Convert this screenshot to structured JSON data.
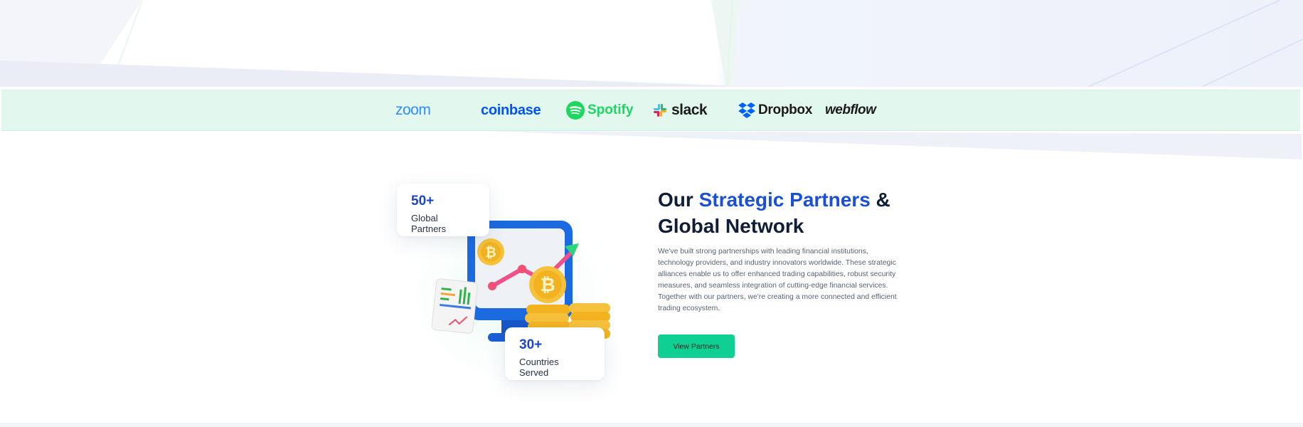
{
  "partners_strip": {
    "logos": [
      {
        "name": "zoom",
        "text": "zoom",
        "icon": "zoom-wordmark",
        "color": "#2d8cff"
      },
      {
        "name": "coinbase",
        "text": "coinbase",
        "icon": "coinbase-wordmark",
        "color": "#0052ff"
      },
      {
        "name": "spotify",
        "text": "Spotify",
        "icon": "spotify-icon",
        "color": "#1ed760"
      },
      {
        "name": "slack",
        "text": "slack",
        "icon": "slack-icon",
        "color": "#1d1c1d"
      },
      {
        "name": "dropbox",
        "text": "Dropbox",
        "icon": "dropbox-icon",
        "color": "#0061fe"
      },
      {
        "name": "webflow",
        "text": "webflow",
        "icon": "webflow-wordmark",
        "color": "#1a1a1a"
      }
    ],
    "background": "#e2f8ef"
  },
  "stats": [
    {
      "value": "50+",
      "label": "Global Partners"
    },
    {
      "value": "30+",
      "label": "Countries Served"
    }
  ],
  "section": {
    "title_prefix": "Our ",
    "title_accent": "Strategic Partners",
    "title_suffix": " & Global Network",
    "description": "We've built strong partnerships with leading financial institutions, technology providers, and industry innovators worldwide. These strategic alliances enable us to offer enhanced trading capabilities, robust security measures, and seamless integration of cutting-edge financial services. Together with our partners, we're creating a more connected and efficient trading ecosystem.",
    "cta_label": "View Partners"
  },
  "illustration": {
    "icon": "crypto-monitor-chart-illustration",
    "coin_icon": "bitcoin-icon"
  },
  "colors": {
    "accent_blue": "#1a4fd8",
    "cta_green": "#10cf92",
    "heading": "#0f1d36"
  }
}
